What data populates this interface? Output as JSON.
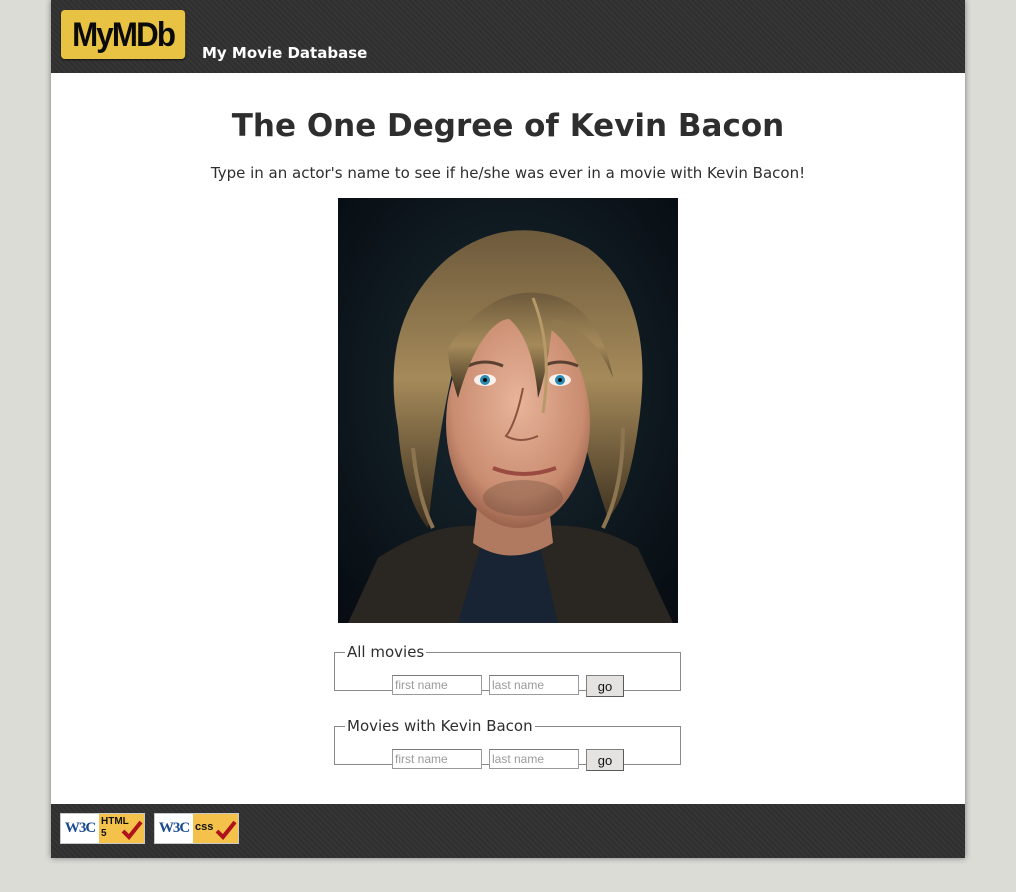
{
  "header": {
    "logo_text": "MyMDb",
    "site_name": "My Movie Database"
  },
  "main": {
    "title": "The One Degree of Kevin Bacon",
    "intro": "Type in an actor's name to see if he/she was ever in a movie with Kevin Bacon!",
    "photo_alt": "Kevin Bacon"
  },
  "forms": {
    "all_movies": {
      "legend": "All movies",
      "first_placeholder": "first name",
      "last_placeholder": "last name",
      "button": "go"
    },
    "with_bacon": {
      "legend": "Movies with Kevin Bacon",
      "first_placeholder": "first name",
      "last_placeholder": "last name",
      "button": "go"
    }
  },
  "footer": {
    "html_badge": {
      "w3c": "W3C",
      "kind": "HTML",
      "version": "5"
    },
    "css_badge": {
      "w3c": "W3C",
      "kind": "css"
    }
  },
  "colors": {
    "banner": "#333333",
    "logo": "#e8c243",
    "background": "#dcdcd7",
    "badge": "#f4c14a",
    "check": "#b0121b"
  }
}
